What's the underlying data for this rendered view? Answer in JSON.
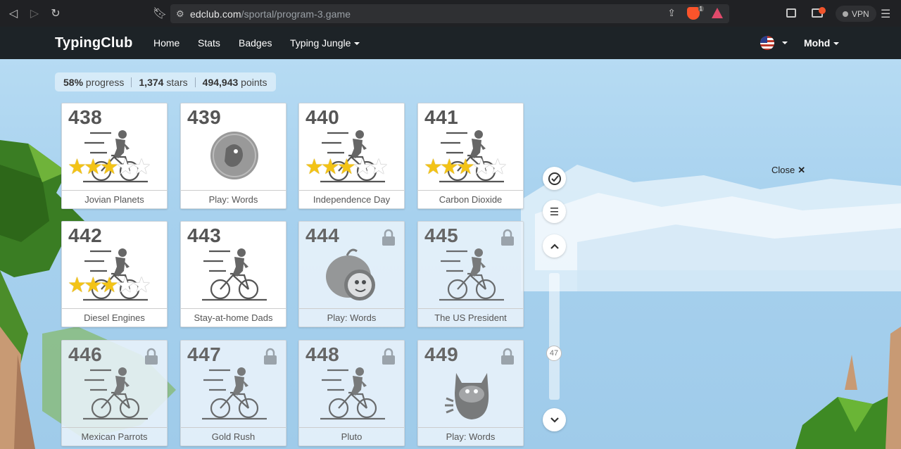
{
  "browser": {
    "url_domain": "edclub.com",
    "url_path": "/sportal/program-3.game",
    "brave_shield_count": "1",
    "vpn_label": "VPN"
  },
  "header": {
    "logo": "TypingClub",
    "nav": [
      "Home",
      "Stats",
      "Badges",
      "Typing Jungle"
    ],
    "user": "Mohd"
  },
  "stats": {
    "progress_value": "58%",
    "progress_label": "progress",
    "stars_value": "1,374",
    "stars_label": "stars",
    "points_value": "494,943",
    "points_label": "points"
  },
  "lessons": [
    {
      "num": "438",
      "name": "Jovian Planets",
      "type": "typing",
      "stars_earned": 3,
      "locked": false
    },
    {
      "num": "439",
      "name": "Play: Words",
      "type": "game",
      "stars_earned": 0,
      "locked": false
    },
    {
      "num": "440",
      "name": "Independence Day",
      "type": "typing",
      "stars_earned": 3,
      "locked": false
    },
    {
      "num": "441",
      "name": "Carbon Dioxide",
      "type": "typing",
      "stars_earned": 3,
      "locked": false
    },
    {
      "num": "442",
      "name": "Diesel Engines",
      "type": "typing",
      "stars_earned": 3,
      "locked": false
    },
    {
      "num": "443",
      "name": "Stay-at-home Dads",
      "type": "typing",
      "stars_earned": 0,
      "locked": false
    },
    {
      "num": "444",
      "name": "Play: Words",
      "type": "game",
      "stars_earned": 0,
      "locked": true
    },
    {
      "num": "445",
      "name": "The US President",
      "type": "typing",
      "stars_earned": 0,
      "locked": true
    },
    {
      "num": "446",
      "name": "Mexican Parrots",
      "type": "typing",
      "stars_earned": 0,
      "locked": true
    },
    {
      "num": "447",
      "name": "Gold Rush",
      "type": "typing",
      "stars_earned": 0,
      "locked": true
    },
    {
      "num": "448",
      "name": "Pluto",
      "type": "typing",
      "stars_earned": 0,
      "locked": true
    },
    {
      "num": "449",
      "name": "Play: Words",
      "type": "game",
      "stars_earned": 0,
      "locked": true
    }
  ],
  "controls": {
    "scroll_position_label": "47",
    "close_label": "Close"
  },
  "colors": {
    "header_bg": "#1d2327",
    "sky": "#a9d3ef",
    "star_gold": "#f3c316"
  }
}
